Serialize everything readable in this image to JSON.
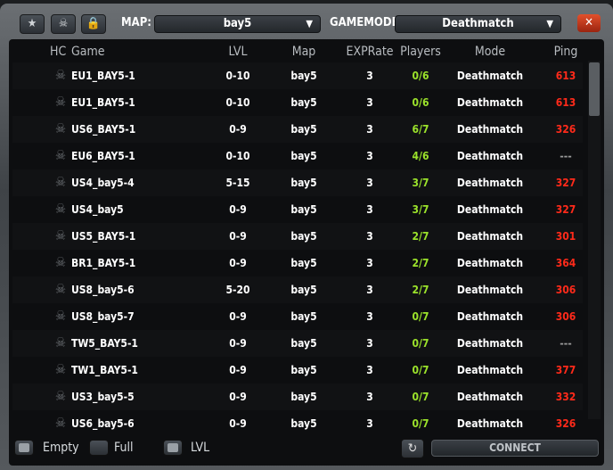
{
  "toolbar": {
    "favorites_icon": "star-icon",
    "hardcore_icon": "skull-icon",
    "locked_icon": "lock-icon",
    "map_label": "MAP:",
    "map_value": "bay5",
    "gamemode_label": "GAMEMODE:",
    "gamemode_value": "Deathmatch",
    "close": "✕"
  },
  "columns": [
    "HC",
    "Game",
    "LVL",
    "Map",
    "EXPRate",
    "Players",
    "Mode",
    "Ping"
  ],
  "colors": {
    "players": "#9be22b",
    "ping": "#ff2a1a",
    "ping_none": "#9a9a9a"
  },
  "rows": [
    {
      "game": "EU1_BAY5-1",
      "lvl": "0-10",
      "map": "bay5",
      "exp": "3",
      "players": "0/6",
      "mode": "Deathmatch",
      "ping": "613"
    },
    {
      "game": "EU1_BAY5-1",
      "lvl": "0-10",
      "map": "bay5",
      "exp": "3",
      "players": "0/6",
      "mode": "Deathmatch",
      "ping": "613"
    },
    {
      "game": "US6_BAY5-1",
      "lvl": "0-9",
      "map": "bay5",
      "exp": "3",
      "players": "6/7",
      "mode": "Deathmatch",
      "ping": "326"
    },
    {
      "game": "EU6_BAY5-1",
      "lvl": "0-10",
      "map": "bay5",
      "exp": "3",
      "players": "4/6",
      "mode": "Deathmatch",
      "ping": "---"
    },
    {
      "game": "US4_bay5-4",
      "lvl": "5-15",
      "map": "bay5",
      "exp": "3",
      "players": "3/7",
      "mode": "Deathmatch",
      "ping": "327"
    },
    {
      "game": "US4_bay5",
      "lvl": "0-9",
      "map": "bay5",
      "exp": "3",
      "players": "3/7",
      "mode": "Deathmatch",
      "ping": "327"
    },
    {
      "game": "US5_BAY5-1",
      "lvl": "0-9",
      "map": "bay5",
      "exp": "3",
      "players": "2/7",
      "mode": "Deathmatch",
      "ping": "301"
    },
    {
      "game": "BR1_BAY5-1",
      "lvl": "0-9",
      "map": "bay5",
      "exp": "3",
      "players": "2/7",
      "mode": "Deathmatch",
      "ping": "364"
    },
    {
      "game": "US8_bay5-6",
      "lvl": "5-20",
      "map": "bay5",
      "exp": "3",
      "players": "2/7",
      "mode": "Deathmatch",
      "ping": "306"
    },
    {
      "game": "US8_bay5-7",
      "lvl": "0-9",
      "map": "bay5",
      "exp": "3",
      "players": "0/7",
      "mode": "Deathmatch",
      "ping": "306"
    },
    {
      "game": "TW5_BAY5-1",
      "lvl": "0-9",
      "map": "bay5",
      "exp": "3",
      "players": "0/7",
      "mode": "Deathmatch",
      "ping": "---"
    },
    {
      "game": "TW1_BAY5-1",
      "lvl": "0-9",
      "map": "bay5",
      "exp": "3",
      "players": "0/7",
      "mode": "Deathmatch",
      "ping": "377"
    },
    {
      "game": "US3_bay5-5",
      "lvl": "0-9",
      "map": "bay5",
      "exp": "3",
      "players": "0/7",
      "mode": "Deathmatch",
      "ping": "332"
    },
    {
      "game": "US6_bay5-6",
      "lvl": "0-9",
      "map": "bay5",
      "exp": "3",
      "players": "0/7",
      "mode": "Deathmatch",
      "ping": "326"
    }
  ],
  "footer": {
    "filters": [
      {
        "label": "Empty",
        "checked": true
      },
      {
        "label": "Full",
        "checked": false
      },
      {
        "label": "LVL",
        "checked": true
      }
    ],
    "refresh_icon": "refresh-icon",
    "connect": "CONNECT"
  }
}
